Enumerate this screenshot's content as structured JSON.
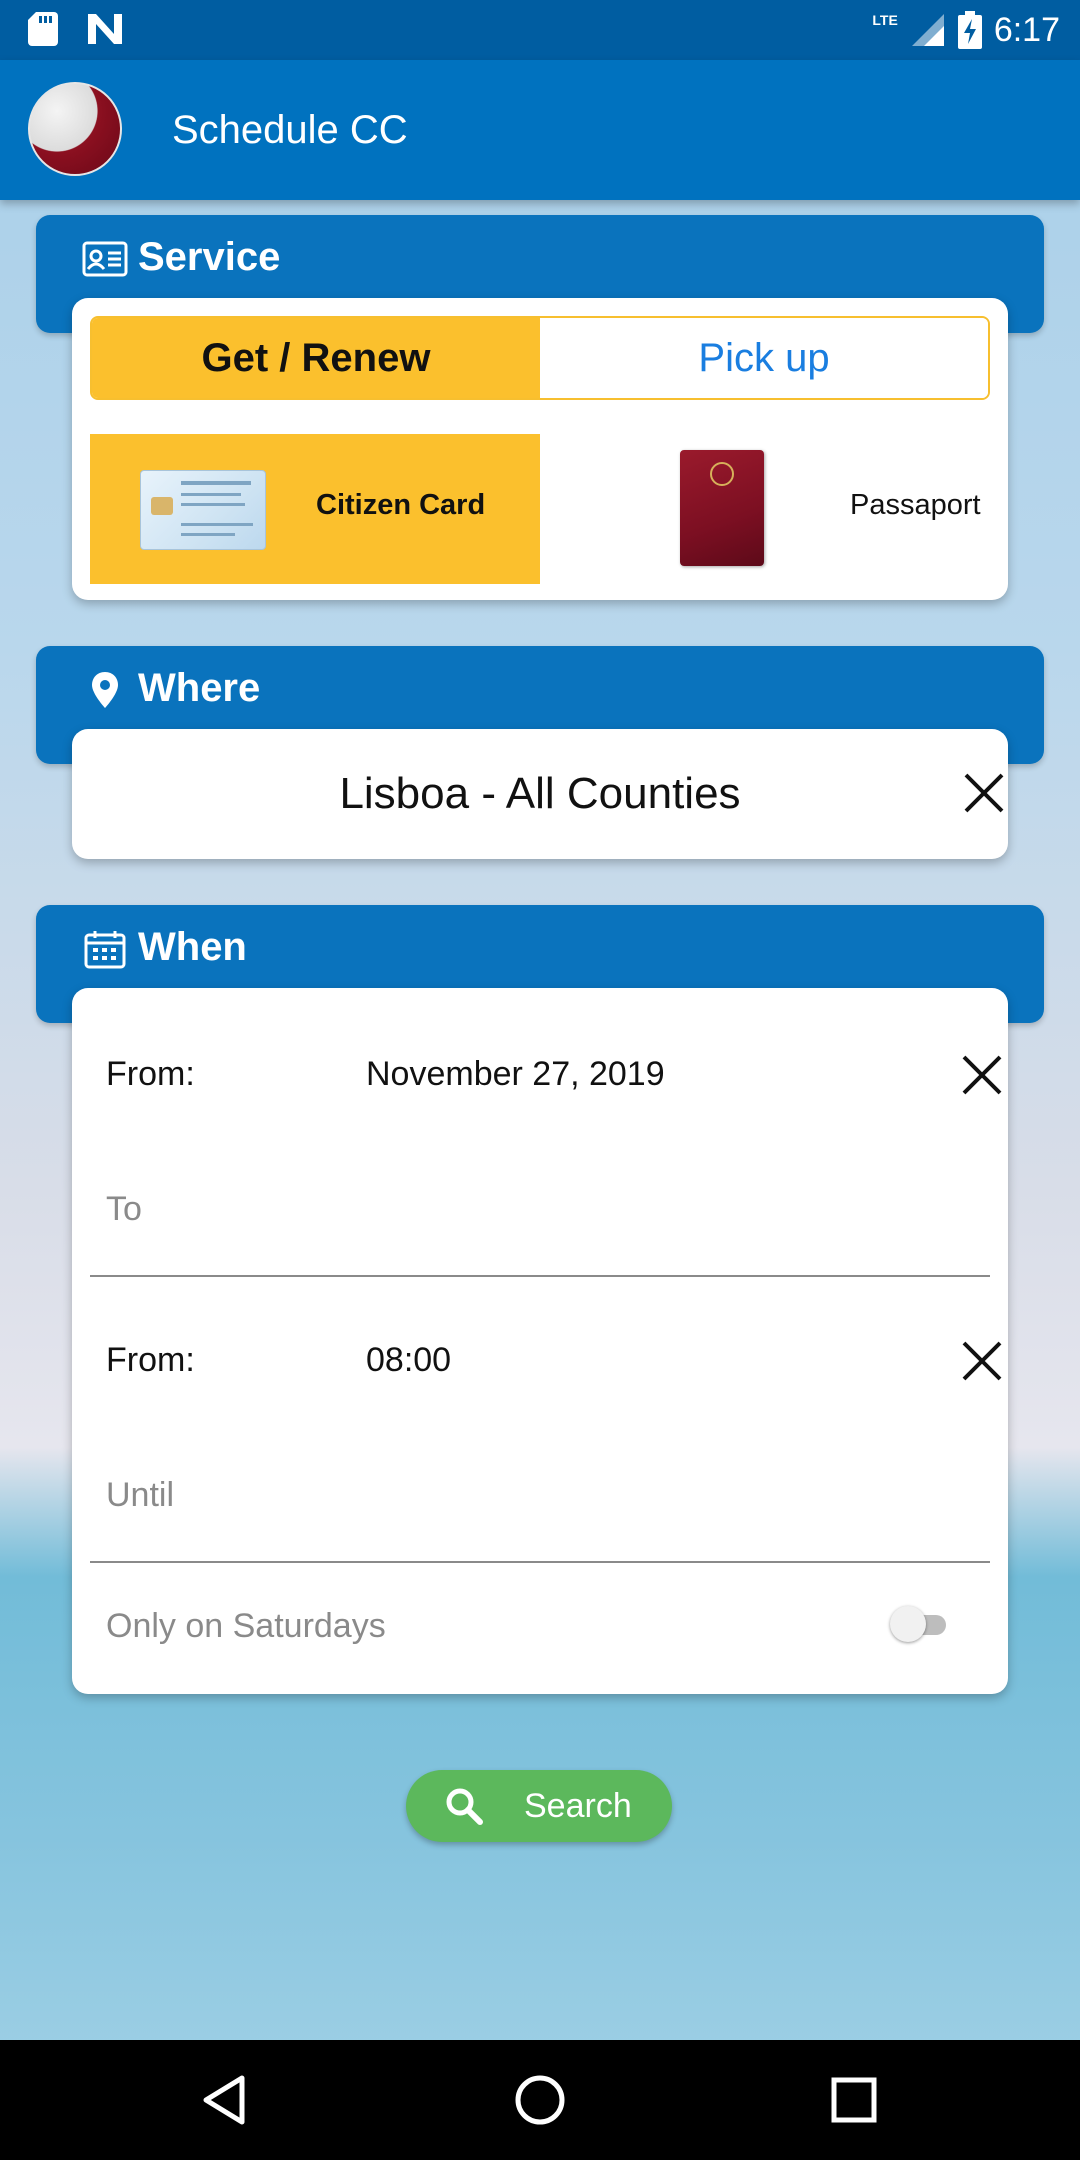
{
  "status_bar": {
    "time": "6:17",
    "network": "LTE",
    "icons": [
      "sd-card-icon",
      "n-logo-icon",
      "signal-icon",
      "battery-charging-icon"
    ]
  },
  "app_bar": {
    "title": "Schedule CC"
  },
  "service": {
    "title": "Service",
    "tabs": [
      {
        "label": "Get / Renew",
        "selected": true
      },
      {
        "label": "Pick up",
        "selected": false
      }
    ],
    "documents": [
      {
        "label": "Citizen Card",
        "selected": true
      },
      {
        "label": "Passaport",
        "selected": false
      }
    ]
  },
  "where": {
    "title": "Where",
    "value": "Lisboa - All Counties"
  },
  "when": {
    "title": "When",
    "date_from_label": "From:",
    "date_from_value": "November 27, 2019",
    "date_to_placeholder": "To",
    "time_from_label": "From:",
    "time_from_value": "08:00",
    "time_until_placeholder": "Until",
    "saturdays_label": "Only on Saturdays",
    "saturdays_enabled": false
  },
  "search": {
    "label": "Search"
  },
  "colors": {
    "primary": "#0072bf",
    "accent": "#fbc02d",
    "link": "#1a7ee0",
    "search": "#5cb85c"
  }
}
